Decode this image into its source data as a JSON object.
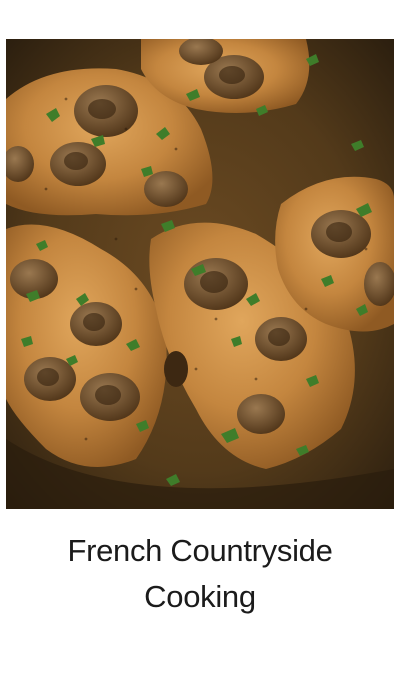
{
  "recipe_card": {
    "title_line1": "French Countryside",
    "title_line2": "Cooking"
  },
  "photo": {
    "subject": "chicken-with-mushroom-sauce",
    "colors": {
      "sauce": "#5a3f1d",
      "chicken": "#c88a44",
      "mushroom": "#7a5a36",
      "herb": "#3d7a28"
    }
  }
}
